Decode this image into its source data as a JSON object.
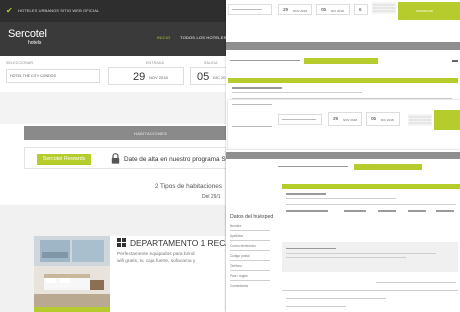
{
  "main": {
    "topbar_tag": "HOTELES URBANOS SITIO WEB OFICIAL",
    "logo": "Sercotel",
    "logo_sub": "hotels",
    "nav": {
      "inicio": "INICIO",
      "hoteles": "TODOS LOS HOTELES"
    },
    "search": {
      "hotel_label": "SELECCIONAR",
      "hotel_value": "HOTEL THE CITY CONDOS",
      "entrada_label": "ENTRADA",
      "entrada_day": "29",
      "entrada_month": "NOV 2018",
      "salida_label": "SALIDA",
      "salida_day": "05",
      "salida_month": "DIC 201"
    },
    "habitaciones_bar": "HABITACIONES",
    "rewards_badge": "Sercotel Rewards",
    "rewards_text": "Date de alta en nuestro programa Se",
    "tipos": "2 Tipos de habitaciones",
    "fecha": "Del 29/1",
    "room_title": "DEPARTAMENTO 1 RECÁMAR",
    "room_desc_1": "Perfectamente equipados para brind",
    "room_desc_2": "wifi gratis, tv, caja fuerte, sofacama y",
    "colors": {
      "accent": "#b5cc2c",
      "dark": "#3a3a3a"
    },
    "icons": [
      "check-icon",
      "lock-icon",
      "grid-icon"
    ]
  },
  "screen1": {
    "day1": "29",
    "month1": "NOV 2018",
    "day2": "05",
    "month2": "DIC 2018",
    "guests": "6",
    "button": "MODIFICAR"
  },
  "screen2": {
    "day1": "29",
    "month1": "NOV 2018",
    "day2": "05",
    "month2": "DIC 2018"
  },
  "sidebar": {
    "heading": "Datos del huésped",
    "items": [
      "Nombre",
      "Apellidos",
      "Correo electrónico",
      "Código postal",
      "Teléfono",
      "País / región",
      "Comentarios"
    ]
  }
}
